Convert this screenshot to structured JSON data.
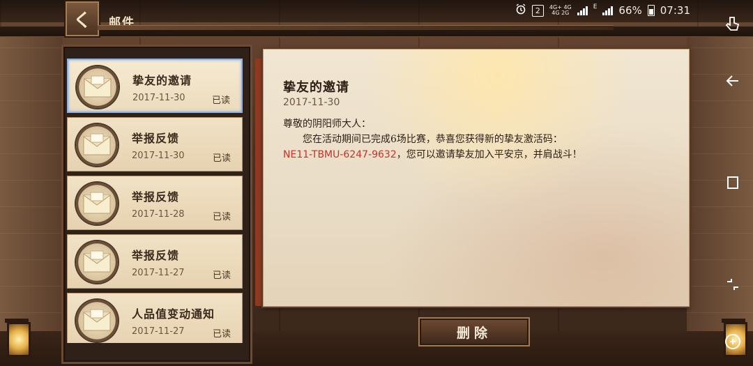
{
  "app": {
    "title": "邮件",
    "back_glyph": "く"
  },
  "status_bar": {
    "sim_badge": "2",
    "network_top": "4G+ 4G",
    "network_bottom": "4G 2G",
    "network_extra": "E",
    "battery": "66%",
    "time": "07:31",
    "icons": [
      "alarm-icon",
      "sim-icon",
      "signal-icon",
      "battery-icon"
    ]
  },
  "mail_list": [
    {
      "title": "挚友的邀请",
      "date": "2017-11-30",
      "status": "已读",
      "selected": true
    },
    {
      "title": "举报反馈",
      "date": "2017-11-30",
      "status": "已读",
      "selected": false
    },
    {
      "title": "举报反馈",
      "date": "2017-11-28",
      "status": "已读",
      "selected": false
    },
    {
      "title": "举报反馈",
      "date": "2017-11-27",
      "status": "已读",
      "selected": false
    },
    {
      "title": "人品值变动通知",
      "date": "2017-11-27",
      "status": "已读",
      "selected": false
    }
  ],
  "letter": {
    "title": "挚友的邀请",
    "date": "2017-11-30",
    "greeting": "尊敬的阴阳师大人：",
    "body_part1": "您在活动期间已完成6场比赛，恭喜您获得新的挚友激活码：",
    "code": "NE11-TBMU-6247-9632",
    "body_part2": "，您可以邀请挚友加入平安京，并肩战斗！"
  },
  "actions": {
    "delete_label": "删除"
  },
  "nav_bar": {
    "buttons": [
      "touch-icon",
      "back-icon",
      "recent-apps-icon",
      "home-icon",
      "game-tools-icon"
    ]
  },
  "colors": {
    "code": "#c5322a",
    "selected_border": "#8fb2e6",
    "paper": "#efe4cf",
    "wood_dark": "#2e1d15"
  }
}
